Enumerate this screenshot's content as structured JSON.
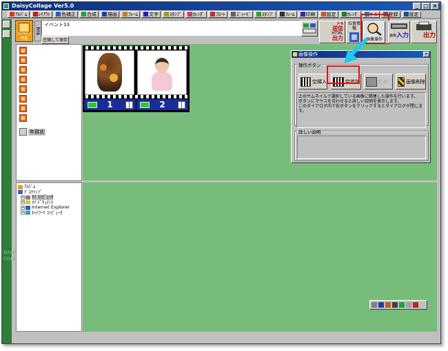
{
  "window": {
    "title": "DaisyCollage Ver5.0",
    "controls": [
      "_",
      "□",
      "×"
    ]
  },
  "toolbar": {
    "items": [
      {
        "label": "ｱﾙﾊﾞﾑ",
        "color": "#d04020"
      },
      {
        "label": "ﾚｲｱｳﾄ",
        "color": "#c02020"
      },
      {
        "label": "色補正",
        "color": "#2060c0"
      },
      {
        "label": "合成",
        "color": "#20a040"
      },
      {
        "label": "描画",
        "color": "#2040a0"
      },
      {
        "label": "ﾌﾚｰﾑ",
        "color": "#c08020"
      },
      {
        "label": "文字",
        "color": "#2020c0"
      },
      {
        "label": "ｽﾀﾝﾌﾟ",
        "color": "#a0a020"
      },
      {
        "label": "ｶﾚﾝﾀﾞ",
        "color": "#c04080"
      },
      {
        "label": "ﾌﾛｰﾄ",
        "color": "#c03030"
      },
      {
        "label": "ｺﾞｯｰﾄﾞ",
        "color": "#606060"
      },
      {
        "label": "ｽﾀﾝﾌﾟ",
        "color": "#30a030"
      },
      {
        "label": "ﾌﾚｰﾑ",
        "color": "#303030"
      },
      {
        "label": "印刷",
        "color": "#303090"
      },
      {
        "label": "設定",
        "color": "#c06020"
      },
      {
        "label": "ｶﾚﾝﾀﾞ",
        "color": "#208020"
      },
      {
        "label": "ﾂｰﾙ",
        "color": "#2080c0"
      },
      {
        "label": "登録",
        "color": "#606060"
      },
      {
        "label": "設定",
        "color": "#205080"
      }
    ]
  },
  "album": {
    "label": "ﾌｫﾄｱﾙﾊﾞﾑ作成",
    "vertical_label": "ﾀｲﾄﾙ"
  },
  "event": {
    "value": "イベント13",
    "save_label": "圧縮して保存"
  },
  "ribbon": {
    "mail_label": "ﾒｰﾙ",
    "send_label": "送信",
    "html_label": "HTML",
    "output_label": "出力",
    "position_label": "位置情報",
    "image_op_label": "画像操作",
    "input_label": "入力",
    "image_small": "画像",
    "output_big": "出力"
  },
  "album_list": {
    "count": 8,
    "nenga_label": "年賀状"
  },
  "tree": {
    "items": [
      {
        "label": "ｱﾙﾊﾞﾑ",
        "level": 0,
        "highlight": false
      },
      {
        "label": "ﾃﾞｽｸﾄｯﾌﾟ",
        "level": 0,
        "highlight": false
      },
      {
        "label": "ﾏｲ ｺﾝﾋﾟｭｰﾀ",
        "level": 1,
        "highlight": true
      },
      {
        "label": "ﾏｲ ﾄﾞｷｭﾒﾝﾄ",
        "level": 1,
        "highlight": false
      },
      {
        "label": "Internet Explorer",
        "level": 1,
        "highlight": false
      },
      {
        "label": "ﾈｯﾄﾜｰｸ ｺﾝﾋﾟｭｰﾀ",
        "level": 1,
        "highlight": false
      }
    ]
  },
  "frames": [
    {
      "number": "1"
    },
    {
      "number": "2"
    }
  ],
  "dialog": {
    "title": "画像操作",
    "group_label": "操作ボタン",
    "buttons": [
      {
        "label": "空挿入",
        "enabled": true
      },
      {
        "label": "空追加",
        "enabled": true
      },
      {
        "label": "ｶﾞｲﾄﾞ",
        "enabled": false
      },
      {
        "label": "画像削除",
        "enabled": true
      }
    ],
    "help_text": "上のサムネイルで選択している画像に関連した操作を行います。\nボタンにマウスを合わせると詳しい説明を表示します。\nこのダイアログ内で右ボタンをクリックするとダイアログが閉じます。",
    "detail_label": "詳しい説明"
  },
  "brand": {
    "vertical": "DAISY COLLAGE"
  },
  "colors": {
    "workspace_green": "#78bc7a",
    "title_blue": "#10307a",
    "highlight_red": "#e01010",
    "arrow_cyan": "#22c8f0"
  }
}
